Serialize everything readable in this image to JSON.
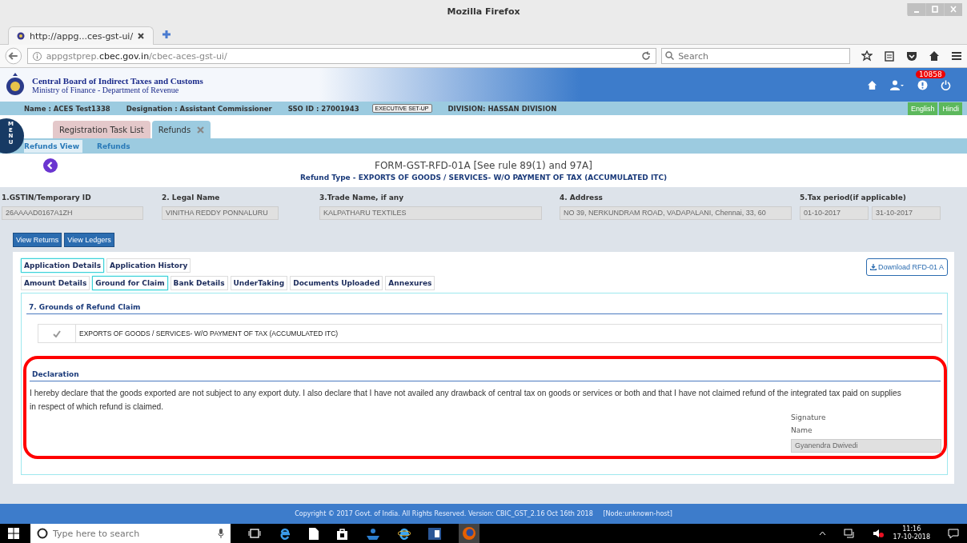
{
  "browser": {
    "title": "Mozilla Firefox",
    "tab_title": "http://appg...ces-gst-ui/",
    "url_pre": "appgstprep.",
    "url_host": "cbec.gov.in",
    "url_post": "/cbec-aces-gst-ui/",
    "search_placeholder": "Search"
  },
  "header": {
    "org_name": "Central Board of Indirect Taxes and Customs",
    "org_sub": "Ministry of Finance - Department of Revenue",
    "notification_count": "10858"
  },
  "info_bar": {
    "name": "Name : ACES Test1338",
    "designation": "Designation : Assistant Commissioner",
    "sso": "SSO ID : 27001943",
    "exec_button": "EXECUTIVE SET-UP",
    "division": "DIVISION:  HASSAN DIVISION",
    "languages": [
      "English",
      "Hindi"
    ]
  },
  "menu_label": "MENU",
  "app_tabs": [
    {
      "label": "Registration Task List",
      "closable": false,
      "selected": false
    },
    {
      "label": "Refunds",
      "closable": true,
      "selected": true
    }
  ],
  "breadcrumb": [
    "Refunds View",
    "Refunds"
  ],
  "form": {
    "title": "FORM-GST-RFD-01A [See rule 89(1) and 97A]",
    "refund_type": "Refund Type - EXPORTS OF GOODS / SERVICES- W/O PAYMENT OF TAX (ACCUMULATED ITC)"
  },
  "fields": [
    {
      "label": "1.GSTIN/Temporary ID",
      "values": [
        "26AAAAD0167A1ZH"
      ]
    },
    {
      "label": "2. Legal Name",
      "values": [
        "VINITHA REDDY PONNALURU"
      ]
    },
    {
      "label": "3.Trade Name, if any",
      "values": [
        "KALPATHARU TEXTILES"
      ]
    },
    {
      "label": "4. Address",
      "values": [
        "NO 39,   NERKUNDRAM ROAD, VADAPALANI, Chennai, 33, 60"
      ]
    },
    {
      "label": "5.Tax period(if applicable)",
      "values": [
        "01-10-2017",
        "31-10-2017"
      ]
    }
  ],
  "action_buttons": [
    "View Returns",
    "View Ledgers"
  ],
  "tabs_row1": [
    {
      "label": "Application Details",
      "selected": true
    },
    {
      "label": "Application History",
      "selected": false
    }
  ],
  "tabs_row2": [
    {
      "label": "Amount Details",
      "selected": false
    },
    {
      "label": "Ground for Claim",
      "selected": true
    },
    {
      "label": "Bank Details",
      "selected": false
    },
    {
      "label": "UnderTaking",
      "selected": false
    },
    {
      "label": "Documents Uploaded",
      "selected": false
    },
    {
      "label": "Annexures",
      "selected": false
    }
  ],
  "download_button": "Download RFD-01 A",
  "grounds": {
    "heading": "7. Grounds of Refund Claim",
    "items": [
      {
        "label": "EXPORTS OF GOODS / SERVICES- W/O PAYMENT OF TAX (ACCUMULATED ITC)",
        "checked": true
      }
    ]
  },
  "declaration": {
    "heading": "Declaration",
    "text": "I hereby declare that the goods exported are not subject to any export duty. I also declare that I have not availed any drawback of central tax on goods or services or both and that I have not claimed refund of the integrated tax paid on supplies in respect of which refund is claimed.",
    "signature_label": "Signature",
    "name_label": "Name",
    "name_value": "Gyanendra Dwivedi",
    "highlighted": true
  },
  "footer": "Copyright © 2017 Govt. of India. All Rights Reserved. Version: CBIC_GST_2.16 Oct 16th 2018     [Node:unknown-host]",
  "taskbar": {
    "search_placeholder": "Type here to search",
    "time": "11:16",
    "date": "17-10-2018"
  }
}
